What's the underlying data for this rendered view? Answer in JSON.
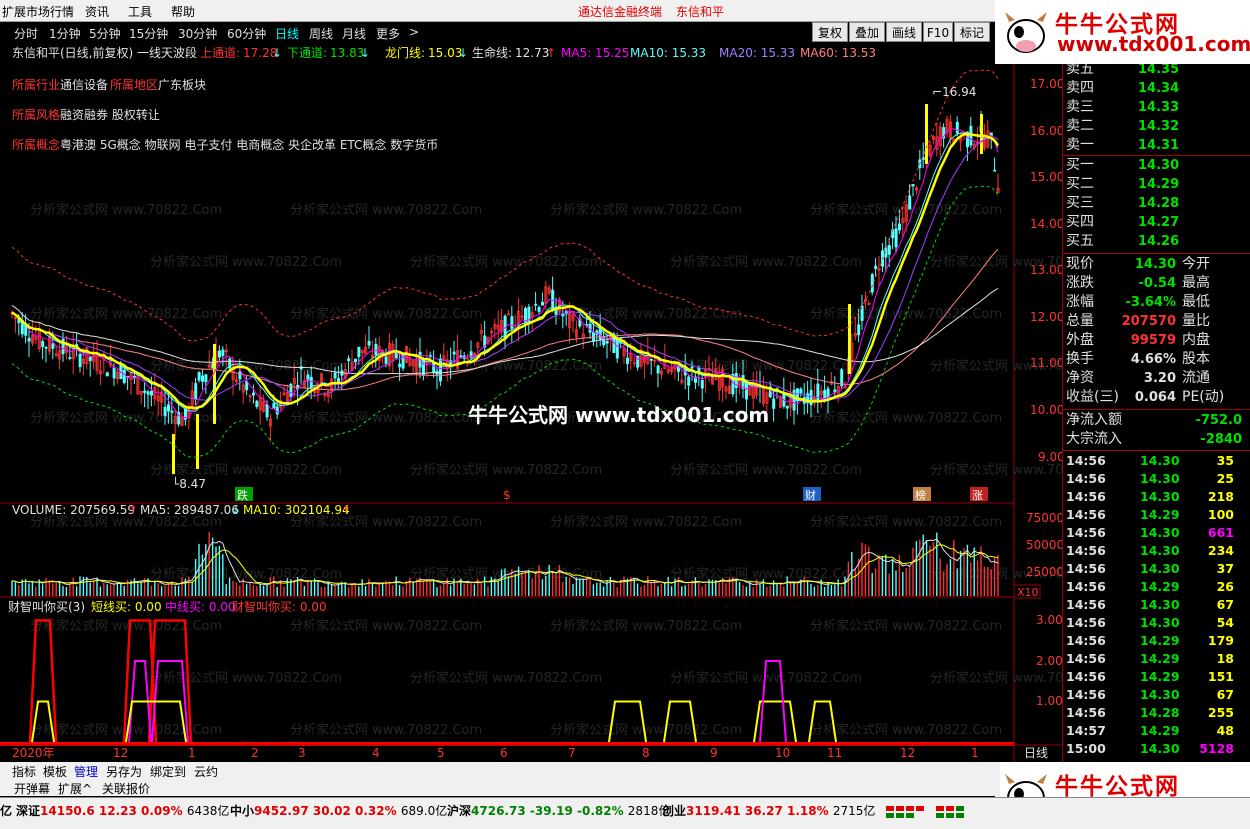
{
  "menu": {
    "items": [
      "扩展市场行情",
      "资讯",
      "工具",
      "帮助"
    ],
    "promo": "通达信金融终端",
    "stock": "东信和平"
  },
  "periods": [
    "分时",
    "1分钟",
    "5分钟",
    "15分钟",
    "30分钟",
    "60分钟",
    "日线",
    "周线",
    "月线",
    "更多",
    ">"
  ],
  "active_period": "日线",
  "toolbar": [
    "复权",
    "叠加",
    "画线",
    "F10",
    "标记"
  ],
  "header": {
    "title": "东信和平(日线,前复权) 一线天波段",
    "upper_label": "上通道:",
    "upper_val": "17.28",
    "lower_label": "下通道:",
    "lower_val": "13.83",
    "dragon_label": "龙门线:",
    "dragon_val": "15.03",
    "life_label": "生命线:",
    "life_val": "12.73",
    "ma5": "MA5: 15.25",
    "ma10": "MA10: 15.33",
    "ma20": "MA20: 15.33",
    "ma60": "MA60: 13.53"
  },
  "info": {
    "industry_label": "所属行业",
    "industry": "通信设备",
    "region_label": "所属地区",
    "region": "广东板块",
    "style_label": "所属风格",
    "style": "融资融券 股权转让",
    "concept_label": "所属概念",
    "concept": "粤港澳 5G概念 物联网 电子支付 电商概念 央企改革 ETC概念 数字货币"
  },
  "watermark": {
    "text": "牛牛公式网 www.tdx001.com",
    "faint": "分析家公式网 www.70822.Com"
  },
  "price_axis": [
    "17.00",
    "16.00",
    "15.00",
    "14.00",
    "13.00",
    "12.00",
    "11.00",
    "10.00",
    "9.00"
  ],
  "marks": {
    "high": "16.94",
    "low": "8.47",
    "die": "跌",
    "s": "$",
    "cai": "财",
    "bang": "榜",
    "zhang": "涨"
  },
  "volume": {
    "label": "VOLUME: 207569.59",
    "ma5": "MA5: 289487.06",
    "ma10": "MA10: 302104.94",
    "axis": [
      "75000",
      "50000",
      "25000"
    ],
    "unit": "X10"
  },
  "indicator": {
    "name": "财智叫你买(3)",
    "short": "短线买: 0.00",
    "mid": "中线买: 0.00",
    "buy": "财智叫你买: 0.00",
    "axis": [
      "3.00",
      "2.00",
      "1.00"
    ]
  },
  "time_axis": {
    "labels": [
      "2020年",
      "12",
      "1",
      "2",
      "3",
      "4",
      "5",
      "6",
      "7",
      "8",
      "9",
      "10",
      "11",
      "12",
      "1"
    ],
    "period": "日线"
  },
  "quotes": {
    "asks": [
      {
        "label": "卖五",
        "price": "14.35"
      },
      {
        "label": "卖四",
        "price": "14.34"
      },
      {
        "label": "卖三",
        "price": "14.33"
      },
      {
        "label": "卖二",
        "price": "14.32"
      },
      {
        "label": "卖一",
        "price": "14.31"
      }
    ],
    "bids": [
      {
        "label": "买一",
        "price": "14.30"
      },
      {
        "label": "买二",
        "price": "14.29"
      },
      {
        "label": "买三",
        "price": "14.28"
      },
      {
        "label": "买四",
        "price": "14.27"
      },
      {
        "label": "买五",
        "price": "14.26"
      }
    ],
    "stats": [
      {
        "l": "现价",
        "v": "14.30",
        "r": "今开"
      },
      {
        "l": "涨跌",
        "v": "-0.54",
        "r": "最高"
      },
      {
        "l": "涨幅",
        "v": "-3.64%",
        "r": "最低"
      },
      {
        "l": "总量",
        "v": "207570",
        "r": "量比"
      },
      {
        "l": "外盘",
        "v": "99579",
        "r": "内盘"
      },
      {
        "l": "换手",
        "v": "4.66%",
        "r": "股本"
      },
      {
        "l": "净资",
        "v": "3.20",
        "r": "流通"
      },
      {
        "l": "收益(三)",
        "v": "0.064",
        "r": "PE(动)"
      }
    ],
    "flow": [
      {
        "l": "净流入额",
        "v": "-752.0"
      },
      {
        "l": "大宗流入",
        "v": "-2840"
      }
    ]
  },
  "ticks": [
    [
      "14:56",
      "14.30",
      "35"
    ],
    [
      "14:56",
      "14.30",
      "25"
    ],
    [
      "14:56",
      "14.30",
      "218"
    ],
    [
      "14:56",
      "14.29",
      "100"
    ],
    [
      "14:56",
      "14.30",
      "661"
    ],
    [
      "14:56",
      "14.30",
      "234"
    ],
    [
      "14:56",
      "14.30",
      "37"
    ],
    [
      "14:56",
      "14.29",
      "26"
    ],
    [
      "14:56",
      "14.30",
      "67"
    ],
    [
      "14:56",
      "14.30",
      "54"
    ],
    [
      "14:56",
      "14.29",
      "179"
    ],
    [
      "14:56",
      "14.29",
      "18"
    ],
    [
      "14:56",
      "14.29",
      "151"
    ],
    [
      "14:56",
      "14.30",
      "67"
    ],
    [
      "14:56",
      "14.28",
      "255"
    ],
    [
      "14:57",
      "14.29",
      "48"
    ],
    [
      "15:00",
      "14.30",
      "5128"
    ]
  ],
  "bottom_tabs": [
    "指标",
    "模板",
    "管理",
    "另存为",
    "绑定到",
    "云约"
  ],
  "bottom_tabs2": [
    "开弹幕",
    "扩展^",
    "关联报价"
  ],
  "status": [
    {
      "n": "深证",
      "v": "14150.6",
      "c": "12.23",
      "p": "0.09%",
      "a": "6438亿"
    },
    {
      "n": "中小",
      "v": "9452.97",
      "c": "30.02",
      "p": "0.32%",
      "a": "689.0亿"
    },
    {
      "n": "沪深",
      "v": "4726.73",
      "c": "-39.19",
      "p": "-0.82%",
      "a": "2818亿"
    },
    {
      "n": "创业",
      "v": "3119.41",
      "c": "36.27",
      "p": "1.18%",
      "a": "2715亿"
    }
  ],
  "colors": {
    "up": "#ff3232",
    "down": "#54ffff",
    "yellow": "#ffff00",
    "magenta": "#ff00ff",
    "green": "#00e000"
  }
}
